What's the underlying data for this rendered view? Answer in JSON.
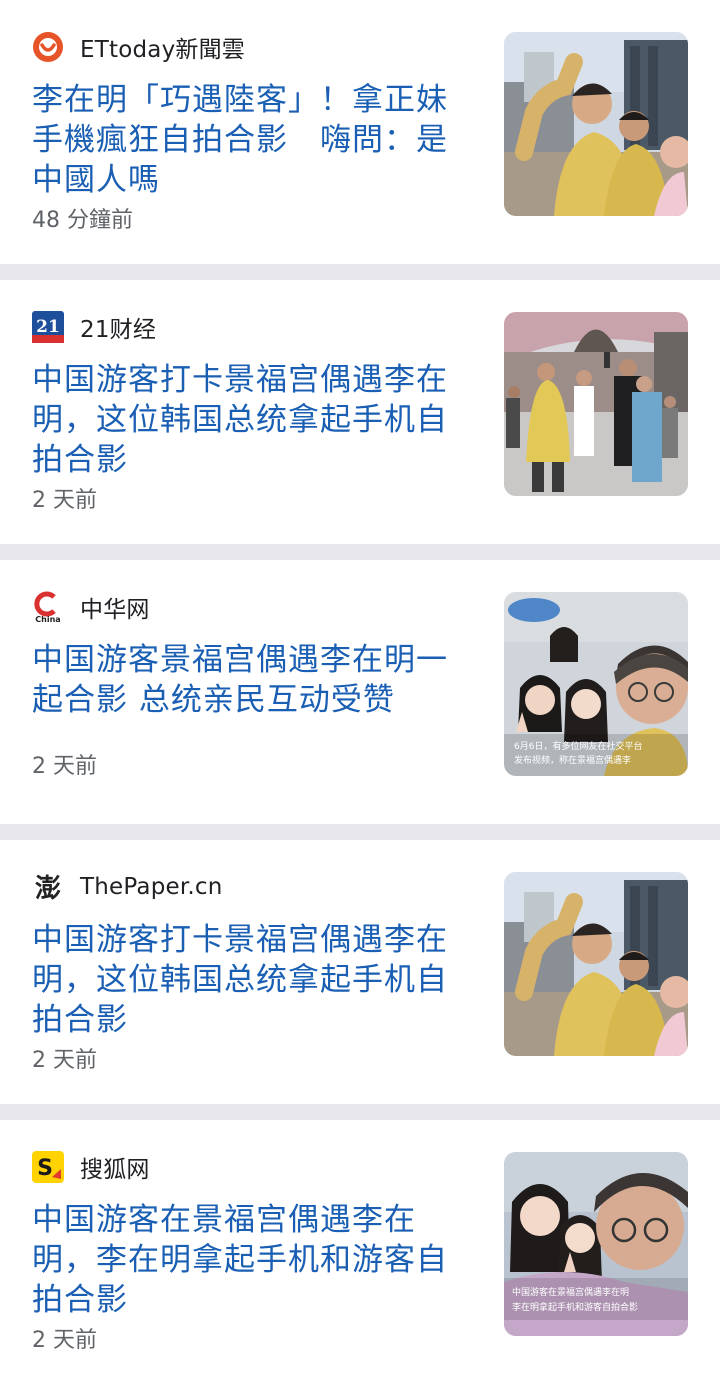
{
  "articles": [
    {
      "source": "ETtoday新聞雲",
      "source_icon": "ettoday-logo-icon",
      "headline": "李在明「巧遇陸客」！拿正妹手機瘋狂自拍合影　嗨問：是中國人嗎",
      "time": "48 分鐘前",
      "thumbnail": "selfie-yellow-jacket-thumbnail"
    },
    {
      "source": "21财经",
      "source_icon": "21caijing-logo-icon",
      "headline": "中国游客打卡景福宫偶遇李在明，这位韩国总统拿起手机自拍合影",
      "time": "2 天前",
      "thumbnail": "palace-crowd-thumbnail"
    },
    {
      "source": "中华网",
      "source_icon": "china-com-logo-icon",
      "headline": "中国游客景福宫偶遇李在明一起合影 总统亲民互动受赞",
      "time": "2 天前",
      "thumbnail": "group-selfie-thumbnail",
      "thumbnail_caption": [
        "6月6日，有多位网友在社交平台",
        "发布视频，称在景福宫偶遇李"
      ]
    },
    {
      "source": "ThePaper.cn",
      "source_icon": "thepaper-logo-icon",
      "headline": "中国游客打卡景福宫偶遇李在明，这位韩国总统拿起手机自拍合影",
      "time": "2 天前",
      "thumbnail": "selfie-yellow-jacket-thumbnail"
    },
    {
      "source": "搜狐网",
      "source_icon": "sohu-logo-icon",
      "headline": "中国游客在景福宫偶遇李在明，李在明拿起手机和游客自拍合影",
      "time": "2 天前",
      "thumbnail": "closeup-selfie-thumbnail",
      "thumbnail_caption": [
        "中国游客在景福宫偶遇李在明",
        "李在明拿起手机和游客自拍合影"
      ]
    }
  ],
  "icon_text": {
    "logo_21": "21",
    "logo_china": "China",
    "logo_thepaper": "澎",
    "logo_sohu": "S"
  },
  "colors": {
    "headline": "#1a5fb4",
    "separator": "#e8e8ec",
    "ettoday_orange": "#e8542a",
    "caijing_blue": "#1d4f9a",
    "sohu_yellow": "#ffd200"
  }
}
